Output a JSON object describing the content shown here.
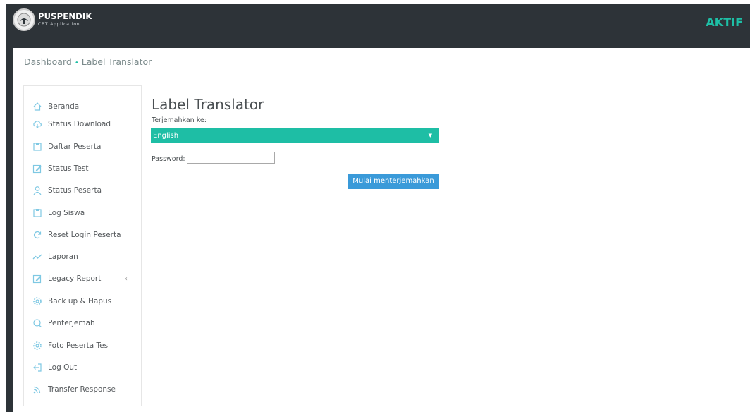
{
  "header": {
    "brand": "PUSPENDIK",
    "brand_sub": "CBT Application",
    "status": "AKTIF",
    "colors": {
      "bar": "#2d3338",
      "accent": "#1ebea5"
    }
  },
  "breadcrumb": {
    "home": "Dashboard",
    "separator": "•",
    "current": "Label Translator"
  },
  "sidebar": {
    "items": [
      {
        "label": "Beranda",
        "icon": "home-icon"
      },
      {
        "label": "Status Download",
        "icon": "cloud-download-icon"
      },
      {
        "label": "Daftar Peserta",
        "icon": "document-icon"
      },
      {
        "label": "Status Test",
        "icon": "edit-icon"
      },
      {
        "label": "Status Peserta",
        "icon": "user-icon"
      },
      {
        "label": "Log Siswa",
        "icon": "document-icon"
      },
      {
        "label": "Reset Login Peserta",
        "icon": "refresh-icon"
      },
      {
        "label": "Laporan",
        "icon": "chart-line-icon"
      },
      {
        "label": "Legacy Report",
        "icon": "edit-icon",
        "chevron": "‹"
      },
      {
        "label": "Back up & Hapus",
        "icon": "gear-icon"
      },
      {
        "label": "Penterjemah",
        "icon": "chat-icon"
      },
      {
        "label": "Foto Peserta Tes",
        "icon": "gear-icon"
      },
      {
        "label": "Log Out",
        "icon": "logout-icon"
      },
      {
        "label": "Transfer Response",
        "icon": "rss-icon"
      }
    ]
  },
  "main": {
    "title": "Label Translator",
    "translate_label": "Terjemahkan ke:",
    "language_selected": "English",
    "password_label": "Password:",
    "password_value": "",
    "start_button": "Mulai menterjemahkan"
  }
}
